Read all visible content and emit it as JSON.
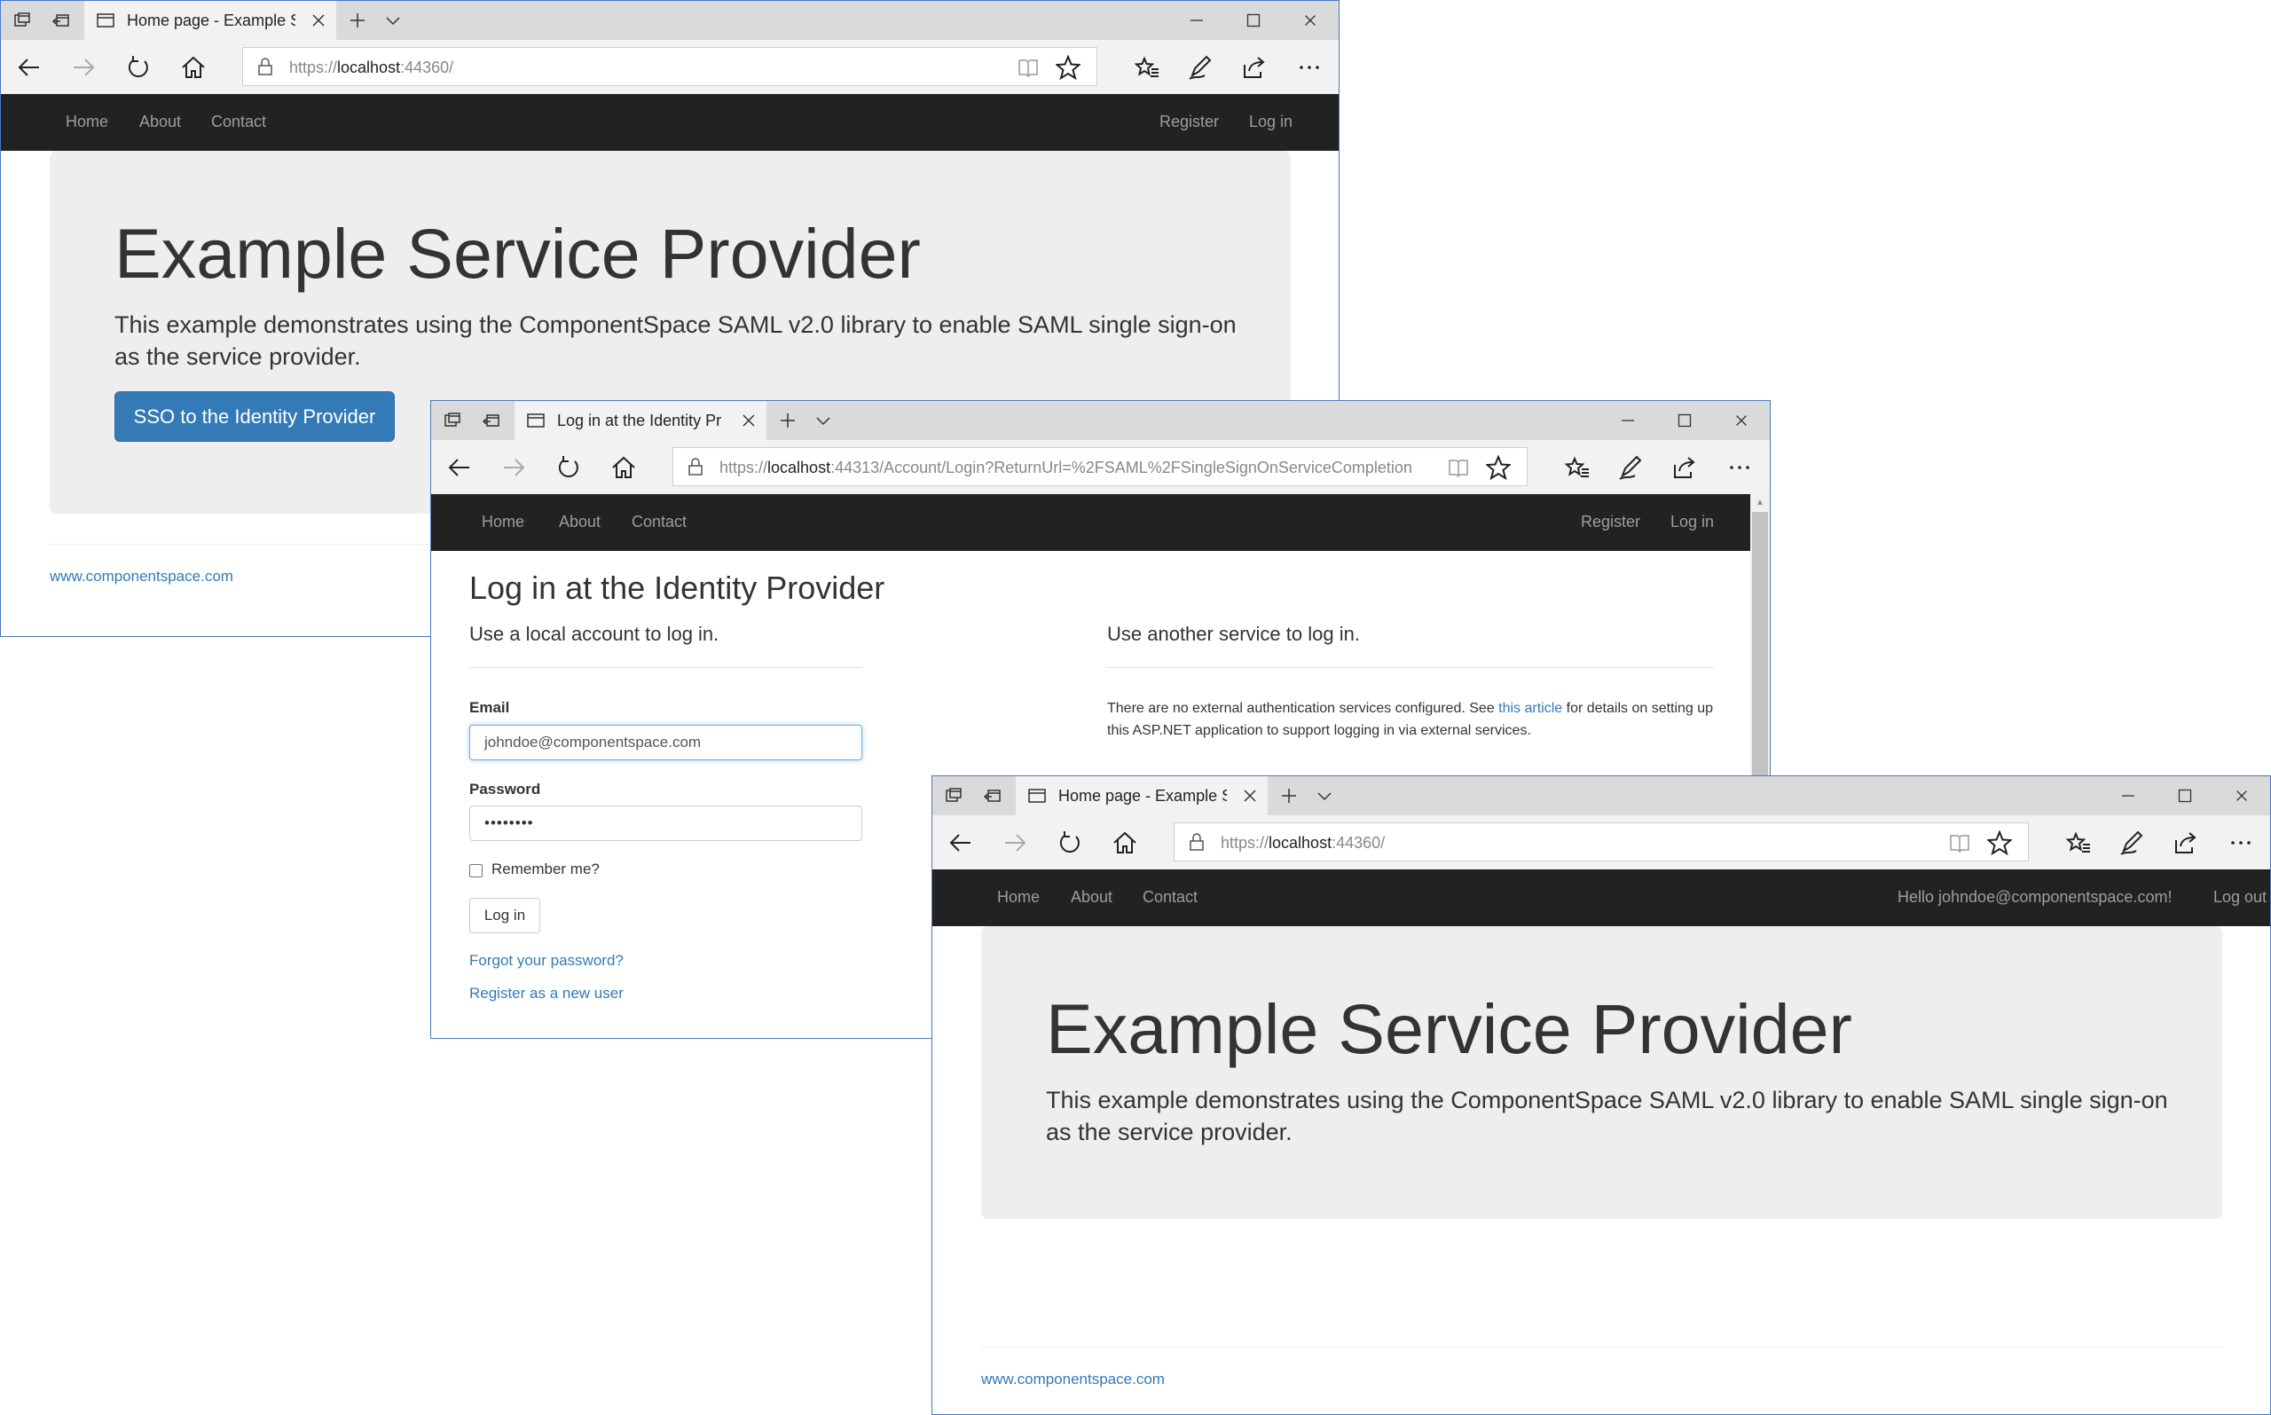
{
  "windows": [
    {
      "tab_title": "Home page - Example S",
      "url_scheme": "https://",
      "url_host": "localhost",
      "url_rest": ":44360/",
      "nav": {
        "home": "Home",
        "about": "About",
        "contact": "Contact",
        "right1": "Register",
        "right2": "Log in"
      },
      "heading": "Example Service Provider",
      "lead": "This example demonstrates using the ComponentSpace SAML v2.0 library to enable SAML single sign-on as the service provider.",
      "button": "SSO to the Identity Provider",
      "footer_link": "www.componentspace.com"
    },
    {
      "tab_title": "Log in at the Identity Pr",
      "url_scheme": "https://",
      "url_host": "localhost",
      "url_rest": ":44313/Account/Login?ReturnUrl=%2FSAML%2FSingleSignOnServiceCompletion",
      "nav": {
        "home": "Home",
        "about": "About",
        "contact": "Contact",
        "right1": "Register",
        "right2": "Log in"
      },
      "heading": "Log in at the Identity Provider",
      "local_heading": "Use a local account to log in.",
      "email_label": "Email",
      "email_value": "johndoe@componentspace.com",
      "password_label": "Password",
      "password_value": "••••••••",
      "remember_label": "Remember me?",
      "login_button": "Log in",
      "forgot_link": "Forgot your password?",
      "register_link": "Register as a new user",
      "external_heading": "Use another service to log in.",
      "external_text_1": "There are no external authentication services configured. See ",
      "external_link": "this article",
      "external_text_2": " for details on setting up this ASP.NET application to support logging in via external services."
    },
    {
      "tab_title": "Home page - Example S",
      "url_scheme": "https://",
      "url_host": "localhost",
      "url_rest": ":44360/",
      "nav": {
        "home": "Home",
        "about": "About",
        "contact": "Contact",
        "right1": "Hello johndoe@componentspace.com!",
        "right2": "Log out"
      },
      "heading": "Example Service Provider",
      "lead": "This example demonstrates using the ComponentSpace SAML v2.0 library to enable SAML single sign-on as the service provider.",
      "footer_link": "www.componentspace.com"
    }
  ],
  "colors": {
    "navbar": "#222222",
    "nav_link": "#9d9d9d",
    "primary": "#337ab7",
    "jumbotron": "#eeeeee",
    "window_border": "#4a78c2"
  },
  "icons": [
    "tab-preview-icon",
    "set-aside-icon",
    "page-icon",
    "close-icon",
    "new-tab-icon",
    "chevron-down-icon",
    "minimize-icon",
    "maximize-icon",
    "back-icon",
    "forward-icon",
    "refresh-icon",
    "home-icon",
    "lock-icon",
    "reading-view-icon",
    "star-icon",
    "favorites-icon",
    "pen-icon",
    "share-icon",
    "more-icon"
  ]
}
